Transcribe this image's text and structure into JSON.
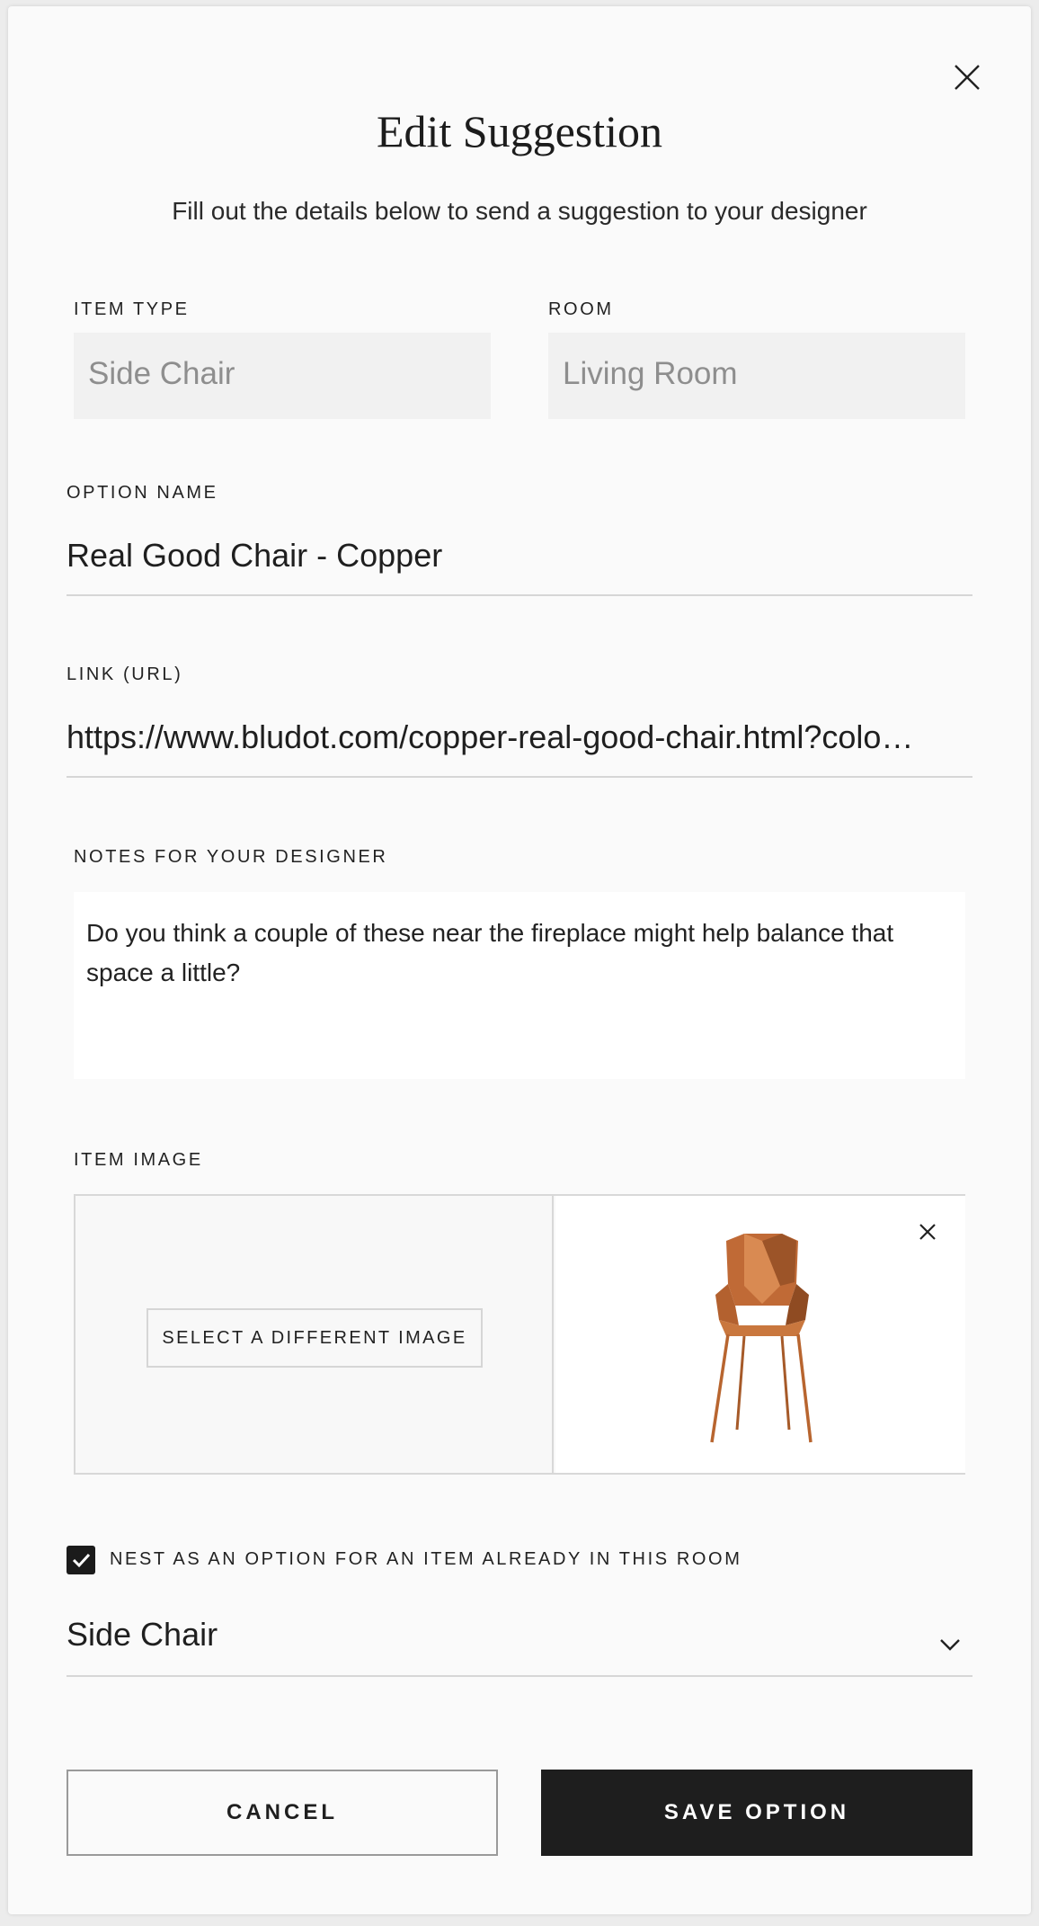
{
  "dialog": {
    "title": "Edit Suggestion",
    "subtitle": "Fill out the details below to send a suggestion to your designer",
    "close_icon": "close-icon"
  },
  "item_type": {
    "label": "ITEM TYPE",
    "value": "Side Chair"
  },
  "room": {
    "label": "ROOM",
    "value": "Living Room"
  },
  "option_name": {
    "label": "OPTION NAME",
    "value": "Real Good Chair - Copper"
  },
  "link": {
    "label": "LINK (URL)",
    "value": "https://www.bludot.com/copper-real-good-chair.html?colo…"
  },
  "notes": {
    "label": "NOTES FOR YOUR DESIGNER",
    "value": "Do you think a couple of these near the fireplace might help balance that space a little?"
  },
  "item_image": {
    "label": "ITEM IMAGE",
    "select_button": "SELECT A DIFFERENT IMAGE",
    "remove_icon": "close-icon",
    "image_name": "copper-chair-image"
  },
  "nest": {
    "checked": true,
    "label": "NEST AS AN OPTION FOR AN ITEM ALREADY IN THIS ROOM",
    "selected_item": "Side Chair",
    "dropdown_icon": "chevron-down-icon"
  },
  "actions": {
    "cancel": "CANCEL",
    "save": "SAVE OPTION"
  },
  "colors": {
    "primary_button": "#1e1e1e",
    "chair_copper": "#c4703a"
  }
}
